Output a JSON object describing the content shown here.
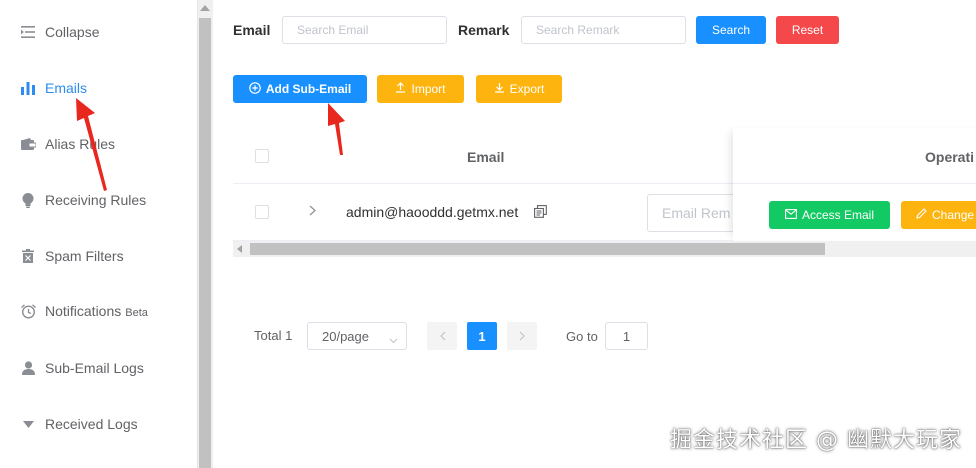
{
  "sidebar": {
    "items": [
      {
        "label": "Collapse",
        "icon": "collapse-icon"
      },
      {
        "label": "Emails",
        "icon": "bar-chart-icon",
        "active": true
      },
      {
        "label": "Alias Rules",
        "icon": "wallet-icon"
      },
      {
        "label": "Receiving Rules",
        "icon": "bulb-icon"
      },
      {
        "label": "Spam Filters",
        "icon": "trash-icon"
      },
      {
        "label": "Notifications",
        "icon": "alarm-clock-icon",
        "badge": "Beta"
      },
      {
        "label": "Sub-Email Logs",
        "icon": "user-icon"
      },
      {
        "label": "Received Logs",
        "icon": "caret-down-icon"
      }
    ]
  },
  "filters": {
    "email_label": "Email",
    "email_placeholder": "Search Email",
    "remark_label": "Remark",
    "remark_placeholder": "Search Remark",
    "search_label": "Search",
    "reset_label": "Reset"
  },
  "actions": {
    "add_label": "Add Sub-Email",
    "import_label": "Import",
    "export_label": "Export"
  },
  "table": {
    "columns": {
      "email": "Email",
      "operation": "Operati"
    },
    "rows": [
      {
        "email": "admin@haooddd.getmx.net",
        "remark_placeholder": "Email Rem",
        "access_label": "Access Email",
        "change_label": "Change"
      }
    ]
  },
  "pagination": {
    "total_label": "Total 1",
    "page_size": "20/page",
    "current_page": "1",
    "goto_label": "Go to",
    "goto_value": "1"
  },
  "watermark": "掘金技术社区 @ 幽默大玩家",
  "colors": {
    "primary": "#1890ff",
    "danger": "#f5484a",
    "warning": "#fdb40e",
    "success": "#13c963",
    "annotation": "#e8281e"
  }
}
